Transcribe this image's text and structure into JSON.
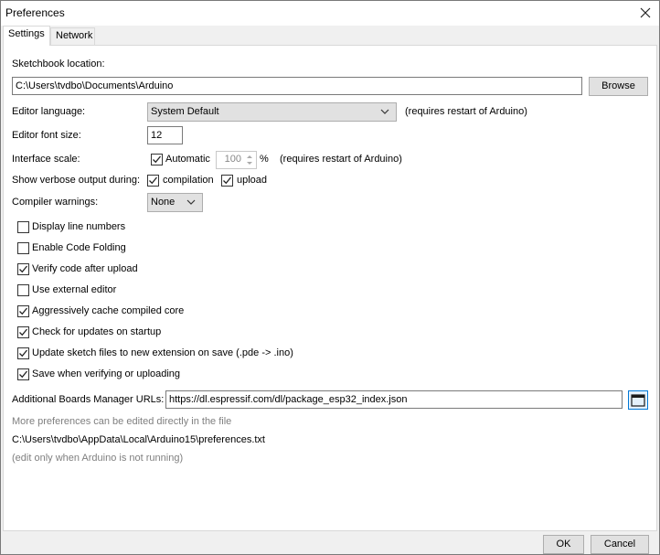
{
  "window": {
    "title": "Preferences"
  },
  "tabs": [
    {
      "label": "Settings",
      "active": true
    },
    {
      "label": "Network",
      "active": false
    }
  ],
  "sketchbook": {
    "label": "Sketchbook location:",
    "path": "C:\\Users\\tvdbo\\Documents\\Arduino",
    "browse_label": "Browse"
  },
  "editor_language": {
    "label": "Editor language:",
    "value": "System Default",
    "note": "(requires restart of Arduino)"
  },
  "font_size": {
    "label": "Editor font size:",
    "value": "12"
  },
  "interface_scale": {
    "label": "Interface scale:",
    "automatic_label": "Automatic",
    "automatic_checked": true,
    "value": "100",
    "unit": "%",
    "note": "(requires restart of Arduino)"
  },
  "verbose": {
    "label": "Show verbose output during:",
    "compilation_label": "compilation",
    "compilation_checked": true,
    "upload_label": "upload",
    "upload_checked": true
  },
  "compiler_warnings": {
    "label": "Compiler warnings:",
    "value": "None"
  },
  "options": [
    {
      "label": "Display line numbers",
      "checked": false
    },
    {
      "label": "Enable Code Folding",
      "checked": false
    },
    {
      "label": "Verify code after upload",
      "checked": true
    },
    {
      "label": "Use external editor",
      "checked": false
    },
    {
      "label": "Aggressively cache compiled core",
      "checked": true
    },
    {
      "label": "Check for updates on startup",
      "checked": true
    },
    {
      "label": "Update sketch files to new extension on save (.pde -> .ino)",
      "checked": true
    },
    {
      "label": "Save when verifying or uploading",
      "checked": true
    }
  ],
  "boards_manager": {
    "label": "Additional Boards Manager URLs:",
    "value": "https://dl.espressif.com/dl/package_esp32_index.json"
  },
  "footer": {
    "more_prefs": "More preferences can be edited directly in the file",
    "prefs_path": "C:\\Users\\tvdbo\\AppData\\Local\\Arduino15\\preferences.txt",
    "edit_note": "(edit only when Arduino is not running)"
  },
  "buttons": {
    "ok": "OK",
    "cancel": "Cancel"
  },
  "colors": {
    "accent": "#0078d7",
    "window_bg": "#f0f0f0",
    "panel_bg": "#ffffff",
    "muted_text": "#7f7f7f"
  }
}
